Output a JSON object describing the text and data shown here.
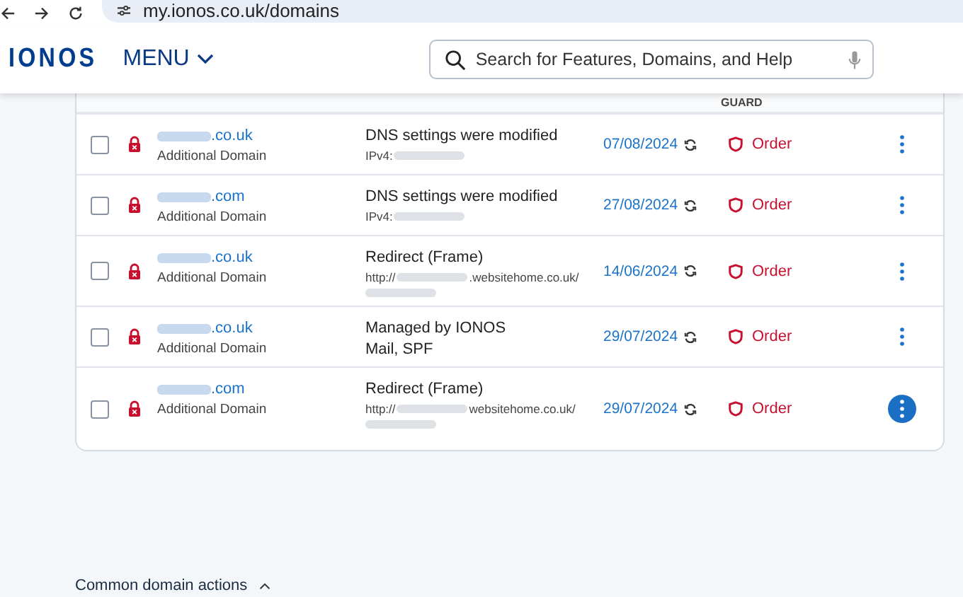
{
  "browser": {
    "url": "my.ionos.co.uk/domains"
  },
  "header": {
    "logo": "IONOS",
    "menu": "MENU",
    "search": {
      "placeholder": "Search for Features, Domains, and Help"
    }
  },
  "table": {
    "column_header": "GUARD",
    "rows": [
      {
        "checked": false,
        "domain_suffix": ".co.uk",
        "type": "Additional Domain",
        "status": "DNS settings were modified",
        "detail_prefix": "IPv4:",
        "kind": "masked",
        "date": "07/08/2024",
        "guard": "Order",
        "selected": false
      },
      {
        "checked": false,
        "domain_suffix": ".com",
        "type": "Additional Domain",
        "status": "DNS settings were modified",
        "detail_prefix": "IPv4:",
        "kind": "masked",
        "date": "27/08/2024",
        "guard": "Order",
        "selected": false
      },
      {
        "checked": false,
        "domain_suffix": ".co.uk",
        "type": "Additional Domain",
        "status": "Redirect (Frame)",
        "detail_prefix": "http://",
        "detail_suffix": ".websitehome.co.uk/",
        "kind": "masked_two_lines",
        "date": "14/06/2024",
        "guard": "Order",
        "selected": false
      },
      {
        "checked": false,
        "domain_suffix": ".co.uk",
        "type": "Additional Domain",
        "status": "Managed by IONOS",
        "detail_prefix": "Mail, SPF",
        "kind": "plain",
        "date": "29/07/2024",
        "guard": "Order",
        "selected": false
      },
      {
        "checked": false,
        "domain_suffix": ".com",
        "type": "Additional Domain",
        "status": "Redirect (Frame)",
        "detail_prefix": "http://",
        "detail_suffix": "websitehome.co.uk/",
        "kind": "masked_two_lines",
        "date": "29/07/2024",
        "guard": "Order",
        "selected": true
      }
    ]
  },
  "footer": {
    "section": "Common domain actions",
    "expanded": true
  }
}
